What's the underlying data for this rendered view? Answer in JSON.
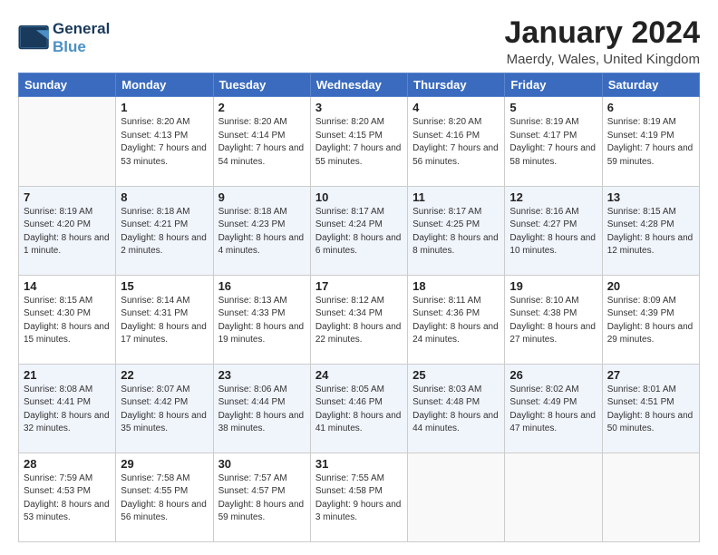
{
  "header": {
    "logo_line1": "General",
    "logo_line2": "Blue",
    "month": "January 2024",
    "location": "Maerdy, Wales, United Kingdom"
  },
  "weekdays": [
    "Sunday",
    "Monday",
    "Tuesday",
    "Wednesday",
    "Thursday",
    "Friday",
    "Saturday"
  ],
  "weeks": [
    [
      {
        "day": "",
        "sunrise": "",
        "sunset": "",
        "daylight": ""
      },
      {
        "day": "1",
        "sunrise": "Sunrise: 8:20 AM",
        "sunset": "Sunset: 4:13 PM",
        "daylight": "Daylight: 7 hours and 53 minutes."
      },
      {
        "day": "2",
        "sunrise": "Sunrise: 8:20 AM",
        "sunset": "Sunset: 4:14 PM",
        "daylight": "Daylight: 7 hours and 54 minutes."
      },
      {
        "day": "3",
        "sunrise": "Sunrise: 8:20 AM",
        "sunset": "Sunset: 4:15 PM",
        "daylight": "Daylight: 7 hours and 55 minutes."
      },
      {
        "day": "4",
        "sunrise": "Sunrise: 8:20 AM",
        "sunset": "Sunset: 4:16 PM",
        "daylight": "Daylight: 7 hours and 56 minutes."
      },
      {
        "day": "5",
        "sunrise": "Sunrise: 8:19 AM",
        "sunset": "Sunset: 4:17 PM",
        "daylight": "Daylight: 7 hours and 58 minutes."
      },
      {
        "day": "6",
        "sunrise": "Sunrise: 8:19 AM",
        "sunset": "Sunset: 4:19 PM",
        "daylight": "Daylight: 7 hours and 59 minutes."
      }
    ],
    [
      {
        "day": "7",
        "sunrise": "Sunrise: 8:19 AM",
        "sunset": "Sunset: 4:20 PM",
        "daylight": "Daylight: 8 hours and 1 minute."
      },
      {
        "day": "8",
        "sunrise": "Sunrise: 8:18 AM",
        "sunset": "Sunset: 4:21 PM",
        "daylight": "Daylight: 8 hours and 2 minutes."
      },
      {
        "day": "9",
        "sunrise": "Sunrise: 8:18 AM",
        "sunset": "Sunset: 4:23 PM",
        "daylight": "Daylight: 8 hours and 4 minutes."
      },
      {
        "day": "10",
        "sunrise": "Sunrise: 8:17 AM",
        "sunset": "Sunset: 4:24 PM",
        "daylight": "Daylight: 8 hours and 6 minutes."
      },
      {
        "day": "11",
        "sunrise": "Sunrise: 8:17 AM",
        "sunset": "Sunset: 4:25 PM",
        "daylight": "Daylight: 8 hours and 8 minutes."
      },
      {
        "day": "12",
        "sunrise": "Sunrise: 8:16 AM",
        "sunset": "Sunset: 4:27 PM",
        "daylight": "Daylight: 8 hours and 10 minutes."
      },
      {
        "day": "13",
        "sunrise": "Sunrise: 8:15 AM",
        "sunset": "Sunset: 4:28 PM",
        "daylight": "Daylight: 8 hours and 12 minutes."
      }
    ],
    [
      {
        "day": "14",
        "sunrise": "Sunrise: 8:15 AM",
        "sunset": "Sunset: 4:30 PM",
        "daylight": "Daylight: 8 hours and 15 minutes."
      },
      {
        "day": "15",
        "sunrise": "Sunrise: 8:14 AM",
        "sunset": "Sunset: 4:31 PM",
        "daylight": "Daylight: 8 hours and 17 minutes."
      },
      {
        "day": "16",
        "sunrise": "Sunrise: 8:13 AM",
        "sunset": "Sunset: 4:33 PM",
        "daylight": "Daylight: 8 hours and 19 minutes."
      },
      {
        "day": "17",
        "sunrise": "Sunrise: 8:12 AM",
        "sunset": "Sunset: 4:34 PM",
        "daylight": "Daylight: 8 hours and 22 minutes."
      },
      {
        "day": "18",
        "sunrise": "Sunrise: 8:11 AM",
        "sunset": "Sunset: 4:36 PM",
        "daylight": "Daylight: 8 hours and 24 minutes."
      },
      {
        "day": "19",
        "sunrise": "Sunrise: 8:10 AM",
        "sunset": "Sunset: 4:38 PM",
        "daylight": "Daylight: 8 hours and 27 minutes."
      },
      {
        "day": "20",
        "sunrise": "Sunrise: 8:09 AM",
        "sunset": "Sunset: 4:39 PM",
        "daylight": "Daylight: 8 hours and 29 minutes."
      }
    ],
    [
      {
        "day": "21",
        "sunrise": "Sunrise: 8:08 AM",
        "sunset": "Sunset: 4:41 PM",
        "daylight": "Daylight: 8 hours and 32 minutes."
      },
      {
        "day": "22",
        "sunrise": "Sunrise: 8:07 AM",
        "sunset": "Sunset: 4:42 PM",
        "daylight": "Daylight: 8 hours and 35 minutes."
      },
      {
        "day": "23",
        "sunrise": "Sunrise: 8:06 AM",
        "sunset": "Sunset: 4:44 PM",
        "daylight": "Daylight: 8 hours and 38 minutes."
      },
      {
        "day": "24",
        "sunrise": "Sunrise: 8:05 AM",
        "sunset": "Sunset: 4:46 PM",
        "daylight": "Daylight: 8 hours and 41 minutes."
      },
      {
        "day": "25",
        "sunrise": "Sunrise: 8:03 AM",
        "sunset": "Sunset: 4:48 PM",
        "daylight": "Daylight: 8 hours and 44 minutes."
      },
      {
        "day": "26",
        "sunrise": "Sunrise: 8:02 AM",
        "sunset": "Sunset: 4:49 PM",
        "daylight": "Daylight: 8 hours and 47 minutes."
      },
      {
        "day": "27",
        "sunrise": "Sunrise: 8:01 AM",
        "sunset": "Sunset: 4:51 PM",
        "daylight": "Daylight: 8 hours and 50 minutes."
      }
    ],
    [
      {
        "day": "28",
        "sunrise": "Sunrise: 7:59 AM",
        "sunset": "Sunset: 4:53 PM",
        "daylight": "Daylight: 8 hours and 53 minutes."
      },
      {
        "day": "29",
        "sunrise": "Sunrise: 7:58 AM",
        "sunset": "Sunset: 4:55 PM",
        "daylight": "Daylight: 8 hours and 56 minutes."
      },
      {
        "day": "30",
        "sunrise": "Sunrise: 7:57 AM",
        "sunset": "Sunset: 4:57 PM",
        "daylight": "Daylight: 8 hours and 59 minutes."
      },
      {
        "day": "31",
        "sunrise": "Sunrise: 7:55 AM",
        "sunset": "Sunset: 4:58 PM",
        "daylight": "Daylight: 9 hours and 3 minutes."
      },
      {
        "day": "",
        "sunrise": "",
        "sunset": "",
        "daylight": ""
      },
      {
        "day": "",
        "sunrise": "",
        "sunset": "",
        "daylight": ""
      },
      {
        "day": "",
        "sunrise": "",
        "sunset": "",
        "daylight": ""
      }
    ]
  ]
}
